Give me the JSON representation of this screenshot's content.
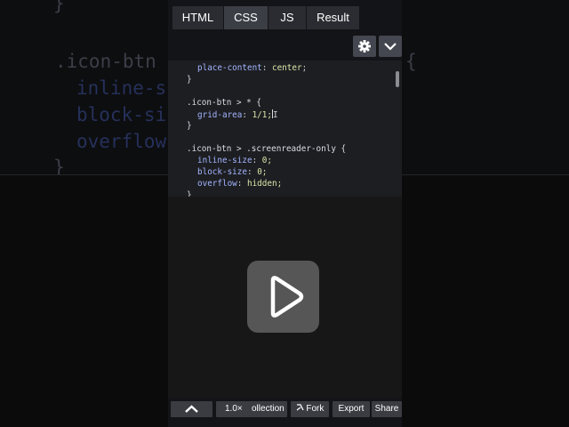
{
  "background": {
    "brace_top": "}",
    "selector": ".icon-btn",
    "brace_right": "{",
    "props": [
      "inline-si",
      "block-si",
      "overflow"
    ],
    "brace_close": "}"
  },
  "tabs": [
    {
      "label": "HTML",
      "active": false
    },
    {
      "label": "CSS",
      "active": true
    },
    {
      "label": "JS",
      "active": false
    },
    {
      "label": "Result",
      "active": false
    }
  ],
  "toolbar": {
    "settings_icon": "gear-icon",
    "collapse_icon": "chevron-down-icon"
  },
  "code": {
    "line1_prop": "place-content",
    "line1_val": "center",
    "line2": "}",
    "line3_sel": ".icon-btn > * {",
    "line4_prop": "grid-area",
    "line4_val": "1/1;",
    "line4_after": "I",
    "line5": "}",
    "line6_sel": ".icon-btn > .screenreader-only {",
    "line7_prop": "inline-size",
    "line7_val": "0;",
    "line8_prop": "block-size",
    "line8_val": "0;",
    "line9_prop": "overflow",
    "line9_val": "hidden;",
    "line10": "}"
  },
  "preview": {
    "play_icon": "play-icon"
  },
  "bottom": {
    "expand_icon": "chevron-up-icon",
    "zoom": "1.0×",
    "collection": "ollection",
    "fork_icon": "fork-icon",
    "fork": "Fork",
    "export": "Export",
    "share": "Share"
  },
  "colors": {
    "panel_bg": "#131417",
    "editor_bg": "#1d1e22",
    "prop": "#a3b5ff",
    "value": "#d9e8a8"
  }
}
